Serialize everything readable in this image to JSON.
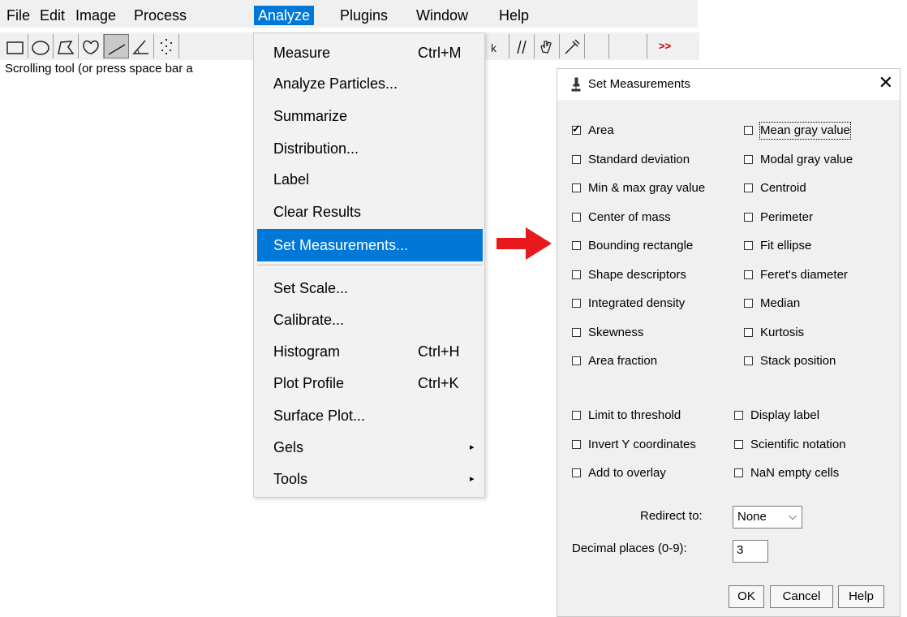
{
  "menubar": {
    "items": [
      "File",
      "Edit",
      "Image",
      "Process",
      "Analyze",
      "Plugins",
      "Window",
      "Help"
    ]
  },
  "toolbar": {
    "tools": [
      "rectangle-tool-icon",
      "oval-tool-icon",
      "polygon-tool-icon",
      "freehand-tool-icon",
      "line-tool-icon",
      "angle-tool-icon",
      "point-tool-icon"
    ],
    "more_label": ">>",
    "more_color": "#cc0000"
  },
  "status_text": "Scrolling tool (or press space bar a",
  "analyze_menu": {
    "items": [
      {
        "label": "Measure",
        "shortcut": "Ctrl+M"
      },
      {
        "label": "Analyze Particles..."
      },
      {
        "label": "Summarize"
      },
      {
        "label": "Distribution..."
      },
      {
        "label": "Label"
      },
      {
        "label": "Clear Results"
      },
      {
        "label": "Set Measurements..."
      },
      {
        "label": "Set Scale..."
      },
      {
        "label": "Calibrate..."
      },
      {
        "label": "Histogram",
        "shortcut": "Ctrl+H"
      },
      {
        "label": "Plot Profile",
        "shortcut": "Ctrl+K"
      },
      {
        "label": "Surface Plot..."
      },
      {
        "label": "Gels",
        "submenu_arrow": "▸"
      },
      {
        "label": "Tools",
        "submenu_arrow": "▸"
      }
    ],
    "highlight_color": "#0078d7"
  },
  "arrow_color": "#e8191c",
  "dialog": {
    "title": "Set Measurements",
    "close_glyph": "✕",
    "measurements": [
      {
        "label": "Area",
        "checked": true
      },
      {
        "label": "Mean gray value",
        "checked": false
      },
      {
        "label": "Standard deviation",
        "checked": false
      },
      {
        "label": "Modal gray value",
        "checked": false
      },
      {
        "label": "Min & max gray value",
        "checked": false
      },
      {
        "label": "Centroid",
        "checked": false
      },
      {
        "label": "Center of mass",
        "checked": false
      },
      {
        "label": "Perimeter",
        "checked": false
      },
      {
        "label": "Bounding rectangle",
        "checked": false
      },
      {
        "label": "Fit ellipse",
        "checked": false
      },
      {
        "label": "Shape descriptors",
        "checked": false
      },
      {
        "label": "Feret's diameter",
        "checked": false
      },
      {
        "label": "Integrated density",
        "checked": false
      },
      {
        "label": "Median",
        "checked": false
      },
      {
        "label": "Skewness",
        "checked": false
      },
      {
        "label": "Kurtosis",
        "checked": false
      },
      {
        "label": "Area fraction",
        "checked": false
      },
      {
        "label": "Stack position",
        "checked": false
      }
    ],
    "options": [
      {
        "label": "Limit to threshold",
        "checked": false
      },
      {
        "label": "Display label",
        "checked": false
      },
      {
        "label": "Invert Y coordinates",
        "checked": false
      },
      {
        "label": "Scientific notation",
        "checked": false
      },
      {
        "label": "Add to overlay",
        "checked": false
      },
      {
        "label": "NaN empty cells",
        "checked": false
      }
    ],
    "check_glyph": "✓",
    "redirect_label": "Redirect to:",
    "redirect_value": "None",
    "dropdown_glyph": "⌵",
    "decimal_label": "Decimal places (0-9):",
    "decimal_value": "3",
    "buttons": {
      "ok": "OK",
      "cancel": "Cancel",
      "help": "Help"
    }
  }
}
